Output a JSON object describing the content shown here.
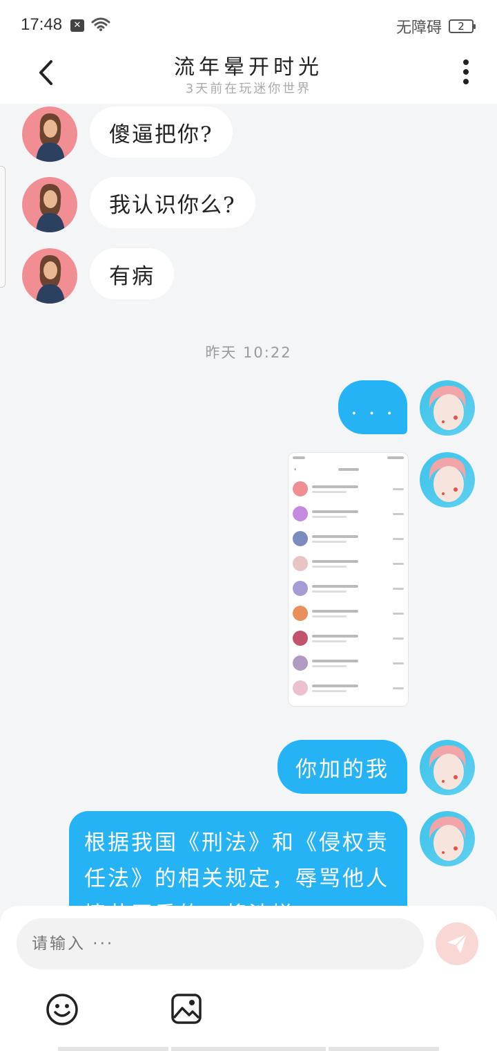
{
  "status": {
    "time": "17:48",
    "accessibility": "无障碍",
    "battery": "2"
  },
  "header": {
    "title": "流年晕开时光",
    "subtitle": "3天前在玩迷你世界"
  },
  "messages": {
    "left": [
      "傻逼把你?",
      "我认识你么?",
      "有病"
    ],
    "divider": "昨天  10:22",
    "right_dots": ". . .",
    "right_added": "你加的我",
    "right_legal": "根据我国《刑法》和《侵权责任法》的相关规定，辱骂他人情节严重的，将涉嫌"
  },
  "input": {
    "placeholder": "请输入 ···"
  },
  "colors": {
    "bubble_self": "#26b3f6",
    "send_btn": "#f9d7d4",
    "avatar_left": "#f08e93",
    "avatar_right": "#3ec3ea"
  },
  "icons": {
    "back": "chevron-left-icon",
    "more": "more-vertical-icon",
    "send": "send-icon",
    "emoji": "emoji-icon",
    "image": "image-icon"
  }
}
